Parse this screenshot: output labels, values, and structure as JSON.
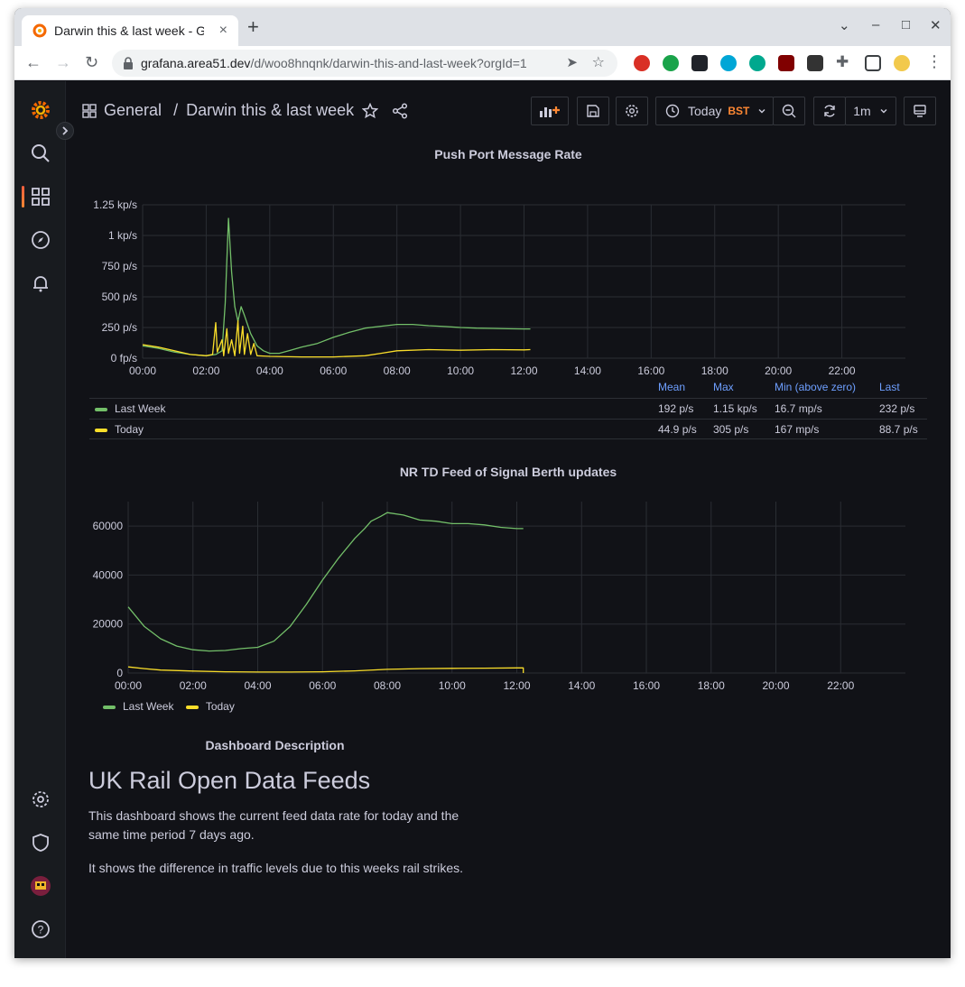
{
  "browser": {
    "tab_title": "Darwin this & last week - G",
    "url_domain": "grafana.area51.dev",
    "url_path": "/d/woo8hnqnk/darwin-this-and-last-week?orgId=1"
  },
  "navbar": {
    "breadcrumb_folder": "General",
    "breadcrumb_separator": "/",
    "dashboard_title": "Darwin this & last week",
    "time_range": "Today",
    "timezone": "BST",
    "refresh_interval": "1m"
  },
  "colors": {
    "last_week": "#73bf69",
    "today": "#fade2a",
    "legend_header": "#6e9fff",
    "accent": "#ff8833"
  },
  "panel1": {
    "title": "Push Port Message Rate",
    "legend_headers": [
      "Mean",
      "Max",
      "Min (above zero)",
      "Last"
    ],
    "legend": [
      {
        "name": "Last Week",
        "mean": "192 p/s",
        "max": "1.15 kp/s",
        "min": "16.7 mp/s",
        "last": "232 p/s"
      },
      {
        "name": "Today",
        "mean": "44.9 p/s",
        "max": "305 p/s",
        "min": "167 mp/s",
        "last": "88.7 p/s"
      }
    ]
  },
  "panel2": {
    "title": "NR TD Feed of Signal Berth updates",
    "legend": [
      "Last Week",
      "Today"
    ]
  },
  "description": {
    "panel_title": "Dashboard Description",
    "heading": "UK Rail Open Data Feeds",
    "paragraph1": "This dashboard shows the current feed data rate for today and the same time period 7 days ago.",
    "paragraph2": "It shows the difference in traffic levels due to this weeks rail strikes."
  },
  "chart_data": [
    {
      "type": "line",
      "title": "Push Port Message Rate",
      "x_ticks": [
        "00:00",
        "02:00",
        "04:00",
        "06:00",
        "08:00",
        "10:00",
        "12:00",
        "14:00",
        "16:00",
        "18:00",
        "20:00",
        "22:00"
      ],
      "y_ticks": [
        "0 fp/s",
        "250 p/s",
        "500 p/s",
        "750 p/s",
        "1 kp/s",
        "1.25 kp/s"
      ],
      "ylim": [
        0,
        1250
      ],
      "xlim": [
        0,
        24
      ],
      "grid": true,
      "legend_position": "bottom",
      "series": [
        {
          "name": "Last Week",
          "color": "#73bf69",
          "points": [
            [
              0,
              100
            ],
            [
              0.5,
              80
            ],
            [
              1,
              50
            ],
            [
              1.5,
              30
            ],
            [
              2,
              20
            ],
            [
              2.3,
              30
            ],
            [
              2.5,
              60
            ],
            [
              2.6,
              450
            ],
            [
              2.7,
              1140
            ],
            [
              2.8,
              700
            ],
            [
              2.9,
              420
            ],
            [
              3.0,
              300
            ],
            [
              3.1,
              420
            ],
            [
              3.2,
              350
            ],
            [
              3.4,
              200
            ],
            [
              3.6,
              100
            ],
            [
              3.8,
              60
            ],
            [
              4.0,
              40
            ],
            [
              4.3,
              40
            ],
            [
              4.6,
              60
            ],
            [
              5,
              90
            ],
            [
              5.5,
              120
            ],
            [
              6,
              170
            ],
            [
              6.5,
              210
            ],
            [
              7,
              245
            ],
            [
              7.5,
              260
            ],
            [
              8,
              275
            ],
            [
              8.5,
              275
            ],
            [
              9,
              265
            ],
            [
              9.5,
              258
            ],
            [
              10,
              250
            ],
            [
              10.5,
              245
            ],
            [
              11,
              243
            ],
            [
              11.5,
              240
            ],
            [
              12,
              238
            ],
            [
              12.2,
              238
            ]
          ]
        },
        {
          "name": "Today",
          "color": "#fade2a",
          "points": [
            [
              0,
              110
            ],
            [
              0.5,
              90
            ],
            [
              1,
              60
            ],
            [
              1.5,
              30
            ],
            [
              2,
              20
            ],
            [
              2.2,
              30
            ],
            [
              2.3,
              290
            ],
            [
              2.35,
              50
            ],
            [
              2.5,
              150
            ],
            [
              2.55,
              20
            ],
            [
              2.65,
              240
            ],
            [
              2.7,
              40
            ],
            [
              2.8,
              150
            ],
            [
              2.9,
              20
            ],
            [
              3.0,
              305
            ],
            [
              3.05,
              40
            ],
            [
              3.15,
              260
            ],
            [
              3.2,
              30
            ],
            [
              3.3,
              200
            ],
            [
              3.4,
              30
            ],
            [
              3.5,
              120
            ],
            [
              3.6,
              20
            ],
            [
              4,
              15
            ],
            [
              5,
              10
            ],
            [
              6,
              10
            ],
            [
              7,
              20
            ],
            [
              7.5,
              40
            ],
            [
              8,
              60
            ],
            [
              9,
              70
            ],
            [
              10,
              65
            ],
            [
              11,
              70
            ],
            [
              12,
              68
            ],
            [
              12.2,
              70
            ]
          ]
        }
      ]
    },
    {
      "type": "line",
      "title": "NR TD Feed of Signal Berth updates",
      "x_ticks": [
        "00:00",
        "02:00",
        "04:00",
        "06:00",
        "08:00",
        "10:00",
        "12:00",
        "14:00",
        "16:00",
        "18:00",
        "20:00",
        "22:00"
      ],
      "y_ticks": [
        "0",
        "20000",
        "40000",
        "60000"
      ],
      "ylim": [
        0,
        70000
      ],
      "xlim": [
        0,
        24
      ],
      "grid": true,
      "legend_position": "bottom",
      "series": [
        {
          "name": "Last Week",
          "color": "#73bf69",
          "points": [
            [
              0,
              27000
            ],
            [
              0.5,
              19000
            ],
            [
              1,
              14000
            ],
            [
              1.5,
              11000
            ],
            [
              2,
              9500
            ],
            [
              2.5,
              9000
            ],
            [
              3,
              9200
            ],
            [
              3.5,
              10000
            ],
            [
              4,
              10500
            ],
            [
              4.5,
              13000
            ],
            [
              5,
              19000
            ],
            [
              5.5,
              28000
            ],
            [
              6,
              38000
            ],
            [
              6.5,
              47000
            ],
            [
              7,
              55000
            ],
            [
              7.3,
              59000
            ],
            [
              7.5,
              62000
            ],
            [
              7.8,
              64000
            ],
            [
              8,
              65500
            ],
            [
              8.5,
              64500
            ],
            [
              9,
              62500
            ],
            [
              9.5,
              62000
            ],
            [
              10,
              61000
            ],
            [
              10.5,
              61000
            ],
            [
              11,
              60500
            ],
            [
              11.5,
              59500
            ],
            [
              12,
              59000
            ],
            [
              12.2,
              59000
            ]
          ]
        },
        {
          "name": "Today",
          "color": "#fade2a",
          "points": [
            [
              0,
              2500
            ],
            [
              0.5,
              1800
            ],
            [
              1,
              1200
            ],
            [
              2,
              800
            ],
            [
              3,
              500
            ],
            [
              4,
              400
            ],
            [
              5,
              400
            ],
            [
              6,
              500
            ],
            [
              7,
              900
            ],
            [
              8,
              1500
            ],
            [
              9,
              1800
            ],
            [
              10,
              1900
            ],
            [
              11,
              2000
            ],
            [
              12,
              2100
            ],
            [
              12.2,
              2100
            ],
            [
              12.2,
              0
            ]
          ]
        }
      ]
    }
  ]
}
